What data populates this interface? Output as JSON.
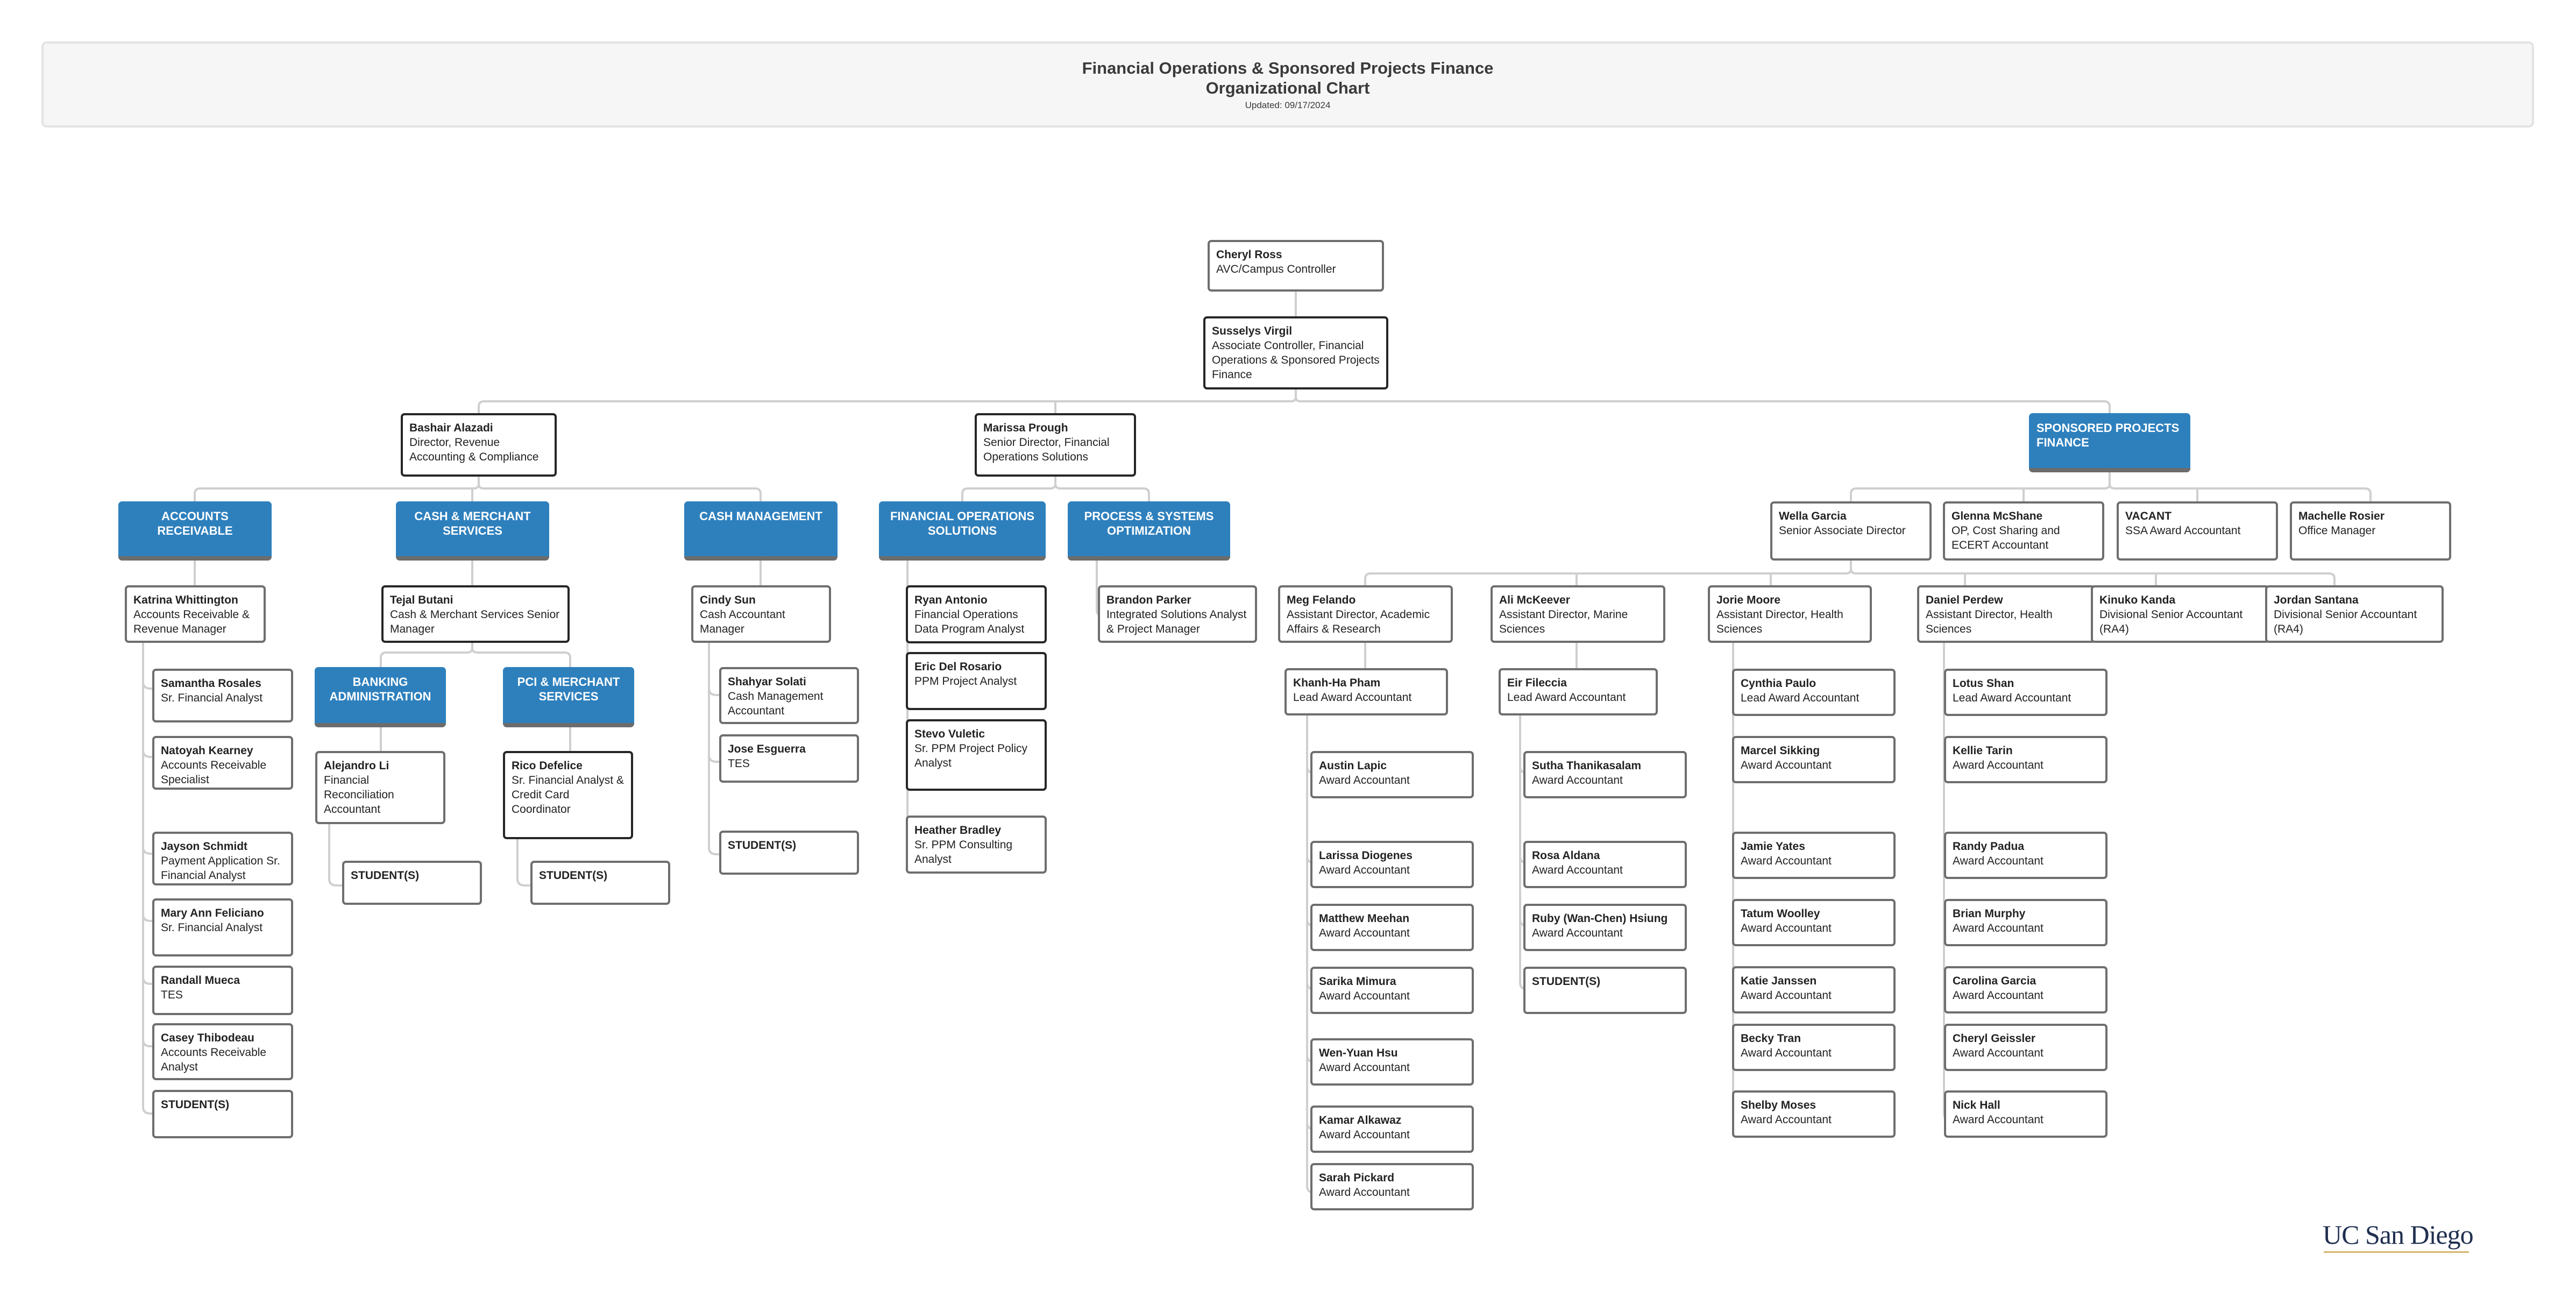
{
  "header": {
    "title_line1": "Financial Operations & Sponsored Projects Finance",
    "title_line2": "Organizational Chart",
    "updated": "Updated: 09/17/2024"
  },
  "colors": {
    "department_fill": "#2e80bd",
    "connector": "#cfcfcf",
    "logo_text": "#1f2f4f",
    "logo_underline": "#d6b56c"
  },
  "logo": {
    "text": "UC San Diego",
    "icon": "uc-san-diego-logo"
  },
  "executives": {
    "cheryl": {
      "name": "Cheryl Ross",
      "title": "AVC/Campus Controller"
    },
    "susselys": {
      "name": "Susselys Virgil",
      "title": "Associate Controller, Financial Operations & Sponsored Projects Finance"
    }
  },
  "directors": {
    "bashair": {
      "name": "Bashair Alazadi",
      "title": "Director, Revenue Accounting & Compliance"
    },
    "marissa": {
      "name": "Marissa Prough",
      "title": "Senior Director, Financial Operations Solutions"
    }
  },
  "departments": {
    "spf": "SPONSORED PROJECTS FINANCE",
    "ar": "ACCOUNTS RECEIVABLE",
    "cms": "CASH & MERCHANT SERVICES",
    "cash": "CASH MANAGEMENT",
    "fos": "FINANCIAL OPERATIONS SOLUTIONS",
    "pso": "PROCESS & SYSTEMS OPTIMIZATION",
    "banking": "BANKING ADMINISTRATION",
    "pci": "PCI & MERCHANT SERVICES"
  },
  "ar": {
    "manager": {
      "name": "Katrina Whittington",
      "title": "Accounts Receivable & Revenue Manager"
    },
    "staff": [
      {
        "name": "Samantha Rosales",
        "title": "Sr. Financial Analyst"
      },
      {
        "name": "Natoyah Kearney",
        "title": "Accounts Receivable Specialist"
      },
      {
        "name": "Jayson Schmidt",
        "title": "Payment Application Sr. Financial Analyst"
      },
      {
        "name": "Mary Ann Feliciano",
        "title": "Sr. Financial Analyst"
      },
      {
        "name": "Randall Mueca",
        "title": "TES"
      },
      {
        "name": "Casey Thibodeau",
        "title": "Accounts Receivable Analyst"
      },
      {
        "name": "STUDENT(S)",
        "title": ""
      }
    ]
  },
  "cms": {
    "manager": {
      "name": "Tejal Butani",
      "title": "Cash & Merchant Services Senior Manager"
    },
    "banking": [
      {
        "name": "Alejandro Li",
        "title": "Financial Reconciliation Accountant"
      },
      {
        "name": "STUDENT(S)",
        "title": ""
      }
    ],
    "pci": [
      {
        "name": "Rico Defelice",
        "title": "Sr. Financial Analyst & Credit Card Coordinator"
      },
      {
        "name": "STUDENT(S)",
        "title": ""
      }
    ]
  },
  "cash": {
    "manager": {
      "name": "Cindy Sun",
      "title": "Cash Accountant Manager"
    },
    "staff": [
      {
        "name": "Shahyar Solati",
        "title": "Cash Management Accountant"
      },
      {
        "name": "Jose Esguerra",
        "title": "TES"
      },
      {
        "name": "STUDENT(S)",
        "title": ""
      }
    ]
  },
  "fos": {
    "staff": [
      {
        "name": "Ryan Antonio",
        "title": "Financial Operations Data Program Analyst"
      },
      {
        "name": "Eric Del Rosario",
        "title": "PPM Project Analyst"
      },
      {
        "name": "Stevo Vuletic",
        "title": "Sr. PPM Project Policy Analyst"
      },
      {
        "name": "Heather Bradley",
        "title": "Sr. PPM Consulting Analyst"
      }
    ]
  },
  "pso": {
    "staff": [
      {
        "name": "Brandon Parker",
        "title": "Integrated Solutions Analyst & Project Manager"
      }
    ]
  },
  "spf": {
    "direct": [
      {
        "name": "Wella Garcia",
        "title": "Senior Associate Director"
      },
      {
        "name": "Glenna McShane",
        "title": "OP, Cost Sharing and ECERT Accountant"
      },
      {
        "name": "VACANT",
        "title": "SSA Award Accountant"
      },
      {
        "name": "Machelle Rosier",
        "title": "Office Manager"
      }
    ],
    "under_wella": [
      {
        "name": "Meg Felando",
        "title": "Assistant Director, Academic Affairs & Research"
      },
      {
        "name": "Ali McKeever",
        "title": "Assistant Director, Marine Sciences"
      },
      {
        "name": "Jorie Moore",
        "title": "Assistant Director, Health Sciences"
      },
      {
        "name": "Daniel Perdew",
        "title": "Assistant Director, Health Sciences"
      },
      {
        "name": "Kinuko Kanda",
        "title": "Divisional Senior Accountant (RA4)"
      },
      {
        "name": "Jordan Santana",
        "title": "Divisional Senior Accountant (RA4)"
      }
    ],
    "meg_team": {
      "lead": {
        "name": "Khanh-Ha Pham",
        "title": "Lead Award Accountant"
      },
      "staff": [
        {
          "name": "Austin Lapic",
          "title": "Award Accountant"
        },
        {
          "name": "Larissa Diogenes",
          "title": "Award Accountant"
        },
        {
          "name": "Matthew Meehan",
          "title": "Award Accountant"
        },
        {
          "name": "Sarika Mimura",
          "title": "Award Accountant"
        },
        {
          "name": "Wen-Yuan Hsu",
          "title": "Award Accountant"
        },
        {
          "name": "Kamar Alkawaz",
          "title": "Award Accountant"
        },
        {
          "name": "Sarah Pickard",
          "title": "Award Accountant"
        }
      ]
    },
    "ali_team": {
      "lead": {
        "name": "Eir Fileccia",
        "title": "Lead Award Accountant"
      },
      "staff": [
        {
          "name": "Sutha Thanikasalam",
          "title": "Award Accountant"
        },
        {
          "name": "Rosa Aldana",
          "title": "Award Accountant"
        },
        {
          "name": "Ruby (Wan-Chen) Hsiung",
          "title": "Award Accountant"
        },
        {
          "name": "STUDENT(S)",
          "title": ""
        }
      ]
    },
    "jorie_team": [
      {
        "name": "Cynthia Paulo",
        "title": "Lead Award Accountant"
      },
      {
        "name": "Marcel Sikking",
        "title": "Award Accountant"
      },
      {
        "name": "Jamie Yates",
        "title": "Award Accountant"
      },
      {
        "name": "Tatum Woolley",
        "title": "Award Accountant"
      },
      {
        "name": "Katie Janssen",
        "title": "Award Accountant"
      },
      {
        "name": "Becky Tran",
        "title": "Award Accountant"
      },
      {
        "name": "Shelby Moses",
        "title": "Award Accountant"
      }
    ],
    "daniel_team": [
      {
        "name": "Lotus Shan",
        "title": "Lead Award Accountant"
      },
      {
        "name": "Kellie Tarin",
        "title": "Award Accountant"
      },
      {
        "name": "Randy Padua",
        "title": "Award Accountant"
      },
      {
        "name": "Brian Murphy",
        "title": "Award Accountant"
      },
      {
        "name": "Carolina Garcia",
        "title": "Award Accountant"
      },
      {
        "name": "Cheryl Geissler",
        "title": "Award Accountant"
      },
      {
        "name": "Nick Hall",
        "title": "Award Accountant"
      }
    ]
  }
}
